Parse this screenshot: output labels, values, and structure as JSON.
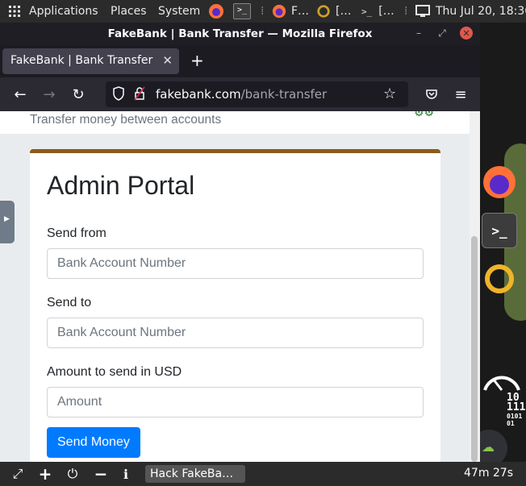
{
  "top_panel": {
    "applications": "Applications",
    "places": "Places",
    "system": "System",
    "task_firefox": "F…",
    "task_2": "[…",
    "task_3": "[…",
    "datetime": "Thu Jul 20, 18:36"
  },
  "window": {
    "title": "FakeBank | Bank Transfer — Mozilla Firefox",
    "tab_label": "FakeBank | Bank Transfer",
    "url_host": "fakebank.com",
    "url_path": "/bank-transfer"
  },
  "page": {
    "subtitle": "Transfer money between accounts",
    "heading": "Admin Portal",
    "send_from_label": "Send from",
    "send_from_placeholder": "Bank Account Number",
    "send_to_label": "Send to",
    "send_to_placeholder": "Bank Account Number",
    "amount_label": "Amount to send in USD",
    "amount_placeholder": "Amount",
    "send_button": "Send Money"
  },
  "bottom_panel": {
    "task_label": "Hack FakeBa…",
    "timer": "47m 27s"
  },
  "desktop": {
    "binary_text_1": "10",
    "binary_text_2": "111",
    "binary_text_3": "0101",
    "binary_text_4": "01"
  },
  "colors": {
    "card_accent": "#8b5a1e",
    "primary_button": "#007bff"
  }
}
